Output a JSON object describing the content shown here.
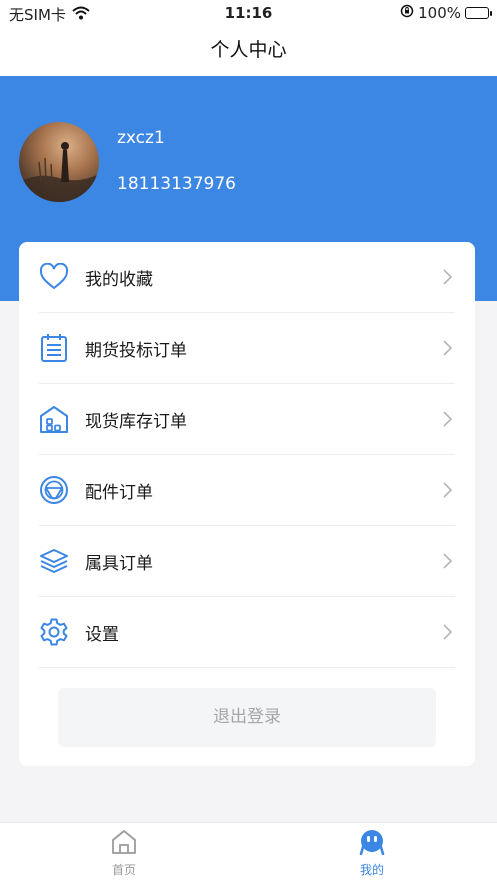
{
  "status_bar": {
    "carrier": "无SIM卡",
    "time": "11:16",
    "battery": "100%"
  },
  "nav": {
    "title": "个人中心"
  },
  "profile": {
    "username": "zxcz1",
    "phone": "18113137976"
  },
  "menu": {
    "items": [
      {
        "label": "我的收藏",
        "icon": "heart-icon"
      },
      {
        "label": "期货投标订单",
        "icon": "clipboard-list-icon"
      },
      {
        "label": "现货库存订单",
        "icon": "warehouse-icon"
      },
      {
        "label": "配件订单",
        "icon": "steering-wheel-icon"
      },
      {
        "label": "属具订单",
        "icon": "layers-icon"
      },
      {
        "label": "设置",
        "icon": "gear-icon"
      }
    ],
    "logout_label": "退出登录"
  },
  "tab_bar": {
    "tabs": [
      {
        "label": "首页",
        "icon": "home-icon",
        "active": false
      },
      {
        "label": "我的",
        "icon": "profile-face-icon",
        "active": true
      }
    ]
  },
  "colors": {
    "accent": "#3c86e4",
    "inactive_tab": "#999999",
    "muted_text": "#a6a6a6"
  }
}
